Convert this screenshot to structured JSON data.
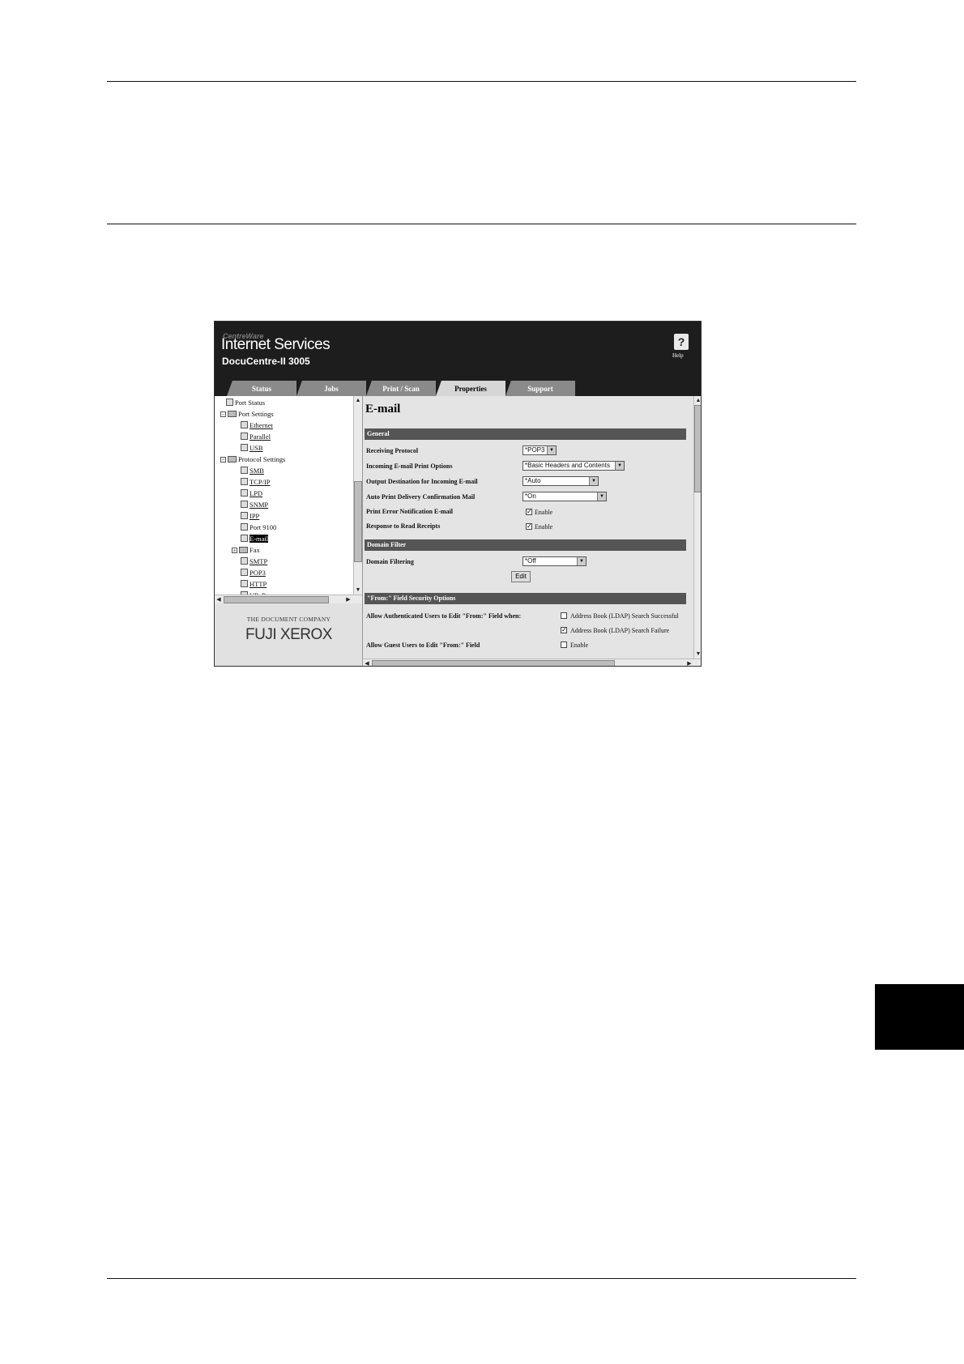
{
  "window": {
    "brand_small": "CentreWare",
    "brand": "Internet Services",
    "model": "DocuCentre-II 3005",
    "help_label": "Help"
  },
  "tabs": [
    "Status",
    "Jobs",
    "Print / Scan",
    "Properties",
    "Support"
  ],
  "active_tab": "Properties",
  "tree": [
    {
      "label": "Port Status",
      "icon": "page-icon",
      "link": false
    },
    {
      "label": "Port Settings",
      "icon": "folder-icon",
      "link": false
    },
    {
      "label": "Ethernet",
      "icon": "page-icon",
      "link": true
    },
    {
      "label": "Parallel",
      "icon": "page-icon",
      "link": true
    },
    {
      "label": "USB",
      "icon": "page-icon",
      "link": true
    },
    {
      "label": "Protocol Settings",
      "icon": "folder-icon",
      "link": false
    },
    {
      "label": "SMB",
      "icon": "page-icon",
      "link": true
    },
    {
      "label": "TCP/IP",
      "icon": "page-icon",
      "link": true
    },
    {
      "label": "LPD",
      "icon": "page-icon",
      "link": true
    },
    {
      "label": "SNMP",
      "icon": "page-icon",
      "link": true
    },
    {
      "label": "IPP",
      "icon": "page-icon",
      "link": true
    },
    {
      "label": "Port 9100",
      "icon": "page-icon",
      "link": false
    },
    {
      "label": "E-mail",
      "icon": "page-icon",
      "link": false,
      "selected": true
    },
    {
      "label": "Fax",
      "icon": "folder-icon",
      "link": false
    },
    {
      "label": "SMTP",
      "icon": "page-icon",
      "link": true
    },
    {
      "label": "POP3",
      "icon": "page-icon",
      "link": true
    },
    {
      "label": "HTTP",
      "icon": "page-icon",
      "link": true
    },
    {
      "label": "UPnP",
      "icon": "page-icon",
      "link": true
    }
  ],
  "logo": {
    "company": "THE DOCUMENT COMPANY",
    "name": "FUJI XEROX"
  },
  "content": {
    "title": "E-mail",
    "general": {
      "header": "General",
      "receiving_protocol": {
        "label": "Receiving Protocol",
        "value": "*POP3"
      },
      "print_options": {
        "label": "Incoming E-mail Print Options",
        "value": "*Basic Headers and Contents"
      },
      "output_destination": {
        "label": "Output Destination for Incoming E-mail",
        "value": "*Auto"
      },
      "auto_print": {
        "label": "Auto Print Delivery Confirmation Mail",
        "value": "*On"
      },
      "print_error": {
        "label": "Print Error Notification E-mail",
        "checkbox": "Enable",
        "checked": true
      },
      "read_receipts": {
        "label": "Response to Read Receipts",
        "checkbox": "Enable",
        "checked": true
      }
    },
    "domain_filter": {
      "header": "Domain Filter",
      "filtering": {
        "label": "Domain Filtering",
        "value": "*Off"
      },
      "edit_button": "Edit"
    },
    "from_field": {
      "header": "\"From:\" Field Security Options",
      "auth_users": {
        "label": "Allow Authenticated Users to Edit \"From:\" Field when:",
        "option1": "Address Book (LDAP) Search Successful",
        "option1_checked": false,
        "option2": "Address Book (LDAP) Search Failure",
        "option2_checked": true
      },
      "guest_users": {
        "label": "Allow Guest Users to Edit \"From:\" Field",
        "checkbox": "Enable",
        "checked": false
      }
    }
  }
}
